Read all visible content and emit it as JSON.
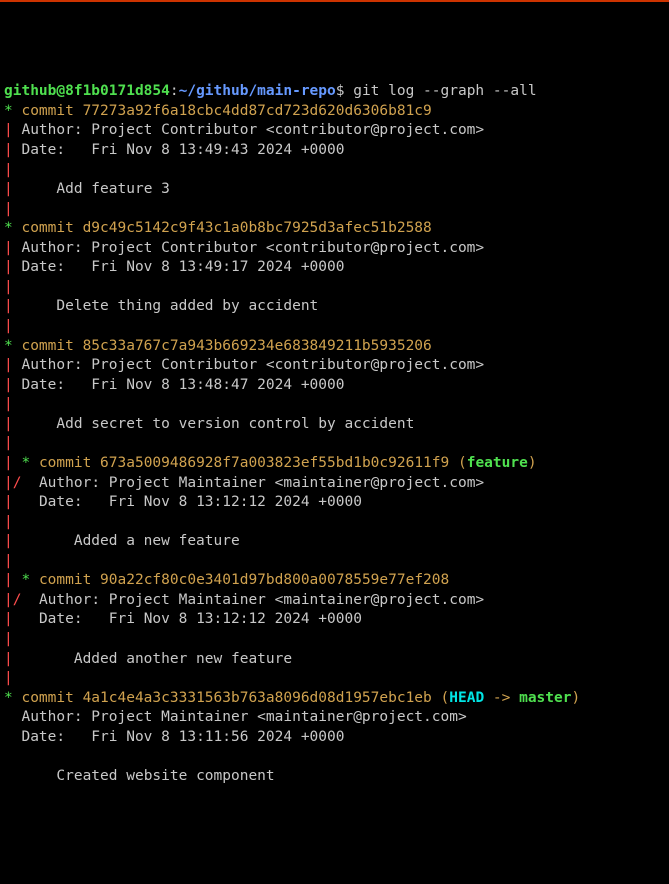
{
  "prompt": {
    "userhost": "github@8f1b0171d854",
    "sep1": ":",
    "path": "~/github/main-repo",
    "sigil": "$ ",
    "command": "git log --graph --all"
  },
  "commits": [
    {
      "hash": "77273a92f6a18cbc4dd87cd723d620d6306b81c9",
      "author": "Project Contributor <contributor@project.com>",
      "date": "Fri Nov 8 13:49:43 2024 +0000",
      "msg": "Add feature 3",
      "graph_lead": [
        "*",
        "|",
        "|",
        "|",
        "|",
        "|"
      ],
      "ref": null
    },
    {
      "hash": "d9c49c5142c9f43c1a0b8bc7925d3afec51b2588",
      "author": "Project Contributor <contributor@project.com>",
      "date": "Fri Nov 8 13:49:17 2024 +0000",
      "msg": "Delete thing added by accident",
      "graph_lead": [
        "*",
        "|",
        "|",
        "|",
        "|",
        "|"
      ],
      "ref": null
    },
    {
      "hash": "85c33a767c7a943b669234e683849211b5935206",
      "author": "Project Contributor <contributor@project.com>",
      "date": "Fri Nov 8 13:48:47 2024 +0000",
      "msg": "Add secret to version control by accident",
      "graph_lead": [
        "*",
        "|",
        "|",
        "|",
        "|",
        "|"
      ],
      "ref": null
    },
    {
      "hash": "673a5009486928f7a003823ef55bd1b0c92611f9",
      "author": "Project Maintainer <maintainer@project.com>",
      "date": "Fri Nov 8 13:12:12 2024 +0000",
      "msg": "Added a new feature",
      "ref": {
        "name": "feature"
      }
    },
    {
      "hash": "90a22cf80c0e3401d97bd800a0078559e77ef208",
      "author": "Project Maintainer <maintainer@project.com>",
      "date": "Fri Nov 8 13:12:12 2024 +0000",
      "msg": "Added another new feature",
      "ref": null
    },
    {
      "hash": "4a1c4e4a3c3331563b763a8096d08d1957ebc1eb",
      "author": "Project Maintainer <maintainer@project.com>",
      "date": "Fri Nov 8 13:11:56 2024 +0000",
      "msg": "Created website component",
      "ref": {
        "head": "HEAD",
        "arrow": " -> ",
        "branch": "master"
      }
    }
  ],
  "labels": {
    "commit_word": "commit ",
    "author_word": "Author: ",
    "date_word": "Date:   "
  }
}
